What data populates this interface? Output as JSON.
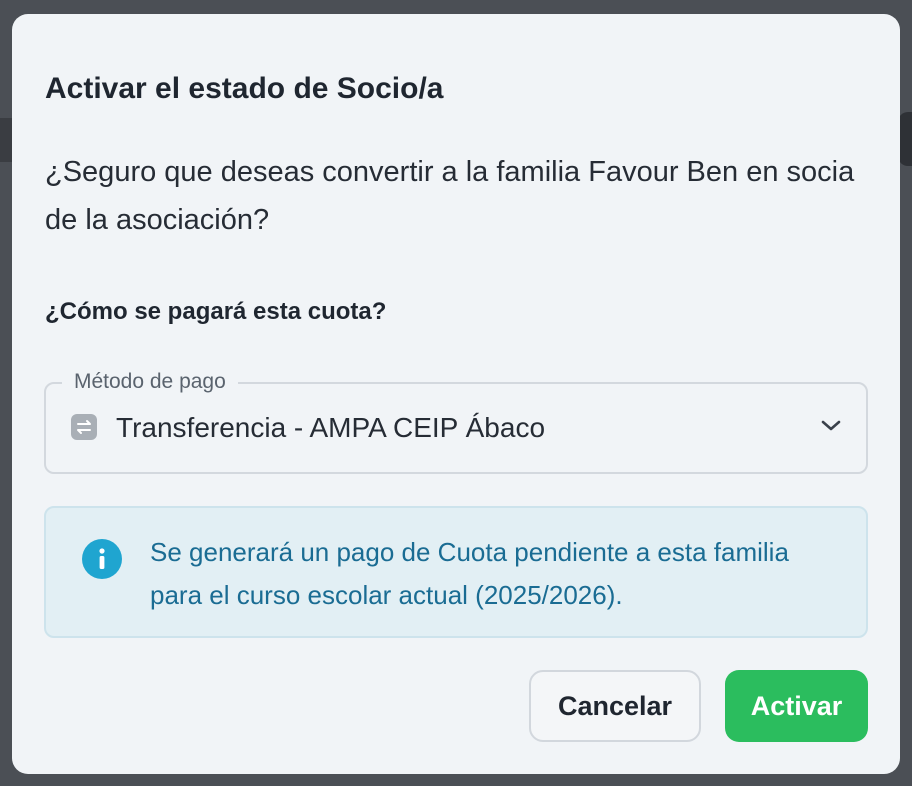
{
  "dialog": {
    "title": "Activar el estado de Socio/a",
    "description": "¿Seguro que deseas convertir a la familia Favour Ben en socia de la asociación?",
    "question": "¿Cómo se pagará esta cuota?"
  },
  "payment_select": {
    "label": "Método de pago",
    "value": "Transferencia - AMPA CEIP Ábaco",
    "icon": "transfer-icon"
  },
  "info": {
    "text": "Se generará un pago de Cuota pendiente a esta familia para el curso escolar actual (2025/2026).",
    "icon": "info-icon"
  },
  "buttons": {
    "cancel": "Cancelar",
    "activate": "Activar"
  },
  "colors": {
    "primary": "#2bbd5e",
    "info_text": "#1a6c93",
    "info_bg": "#e2eff4",
    "info_icon": "#1fa5d0"
  }
}
